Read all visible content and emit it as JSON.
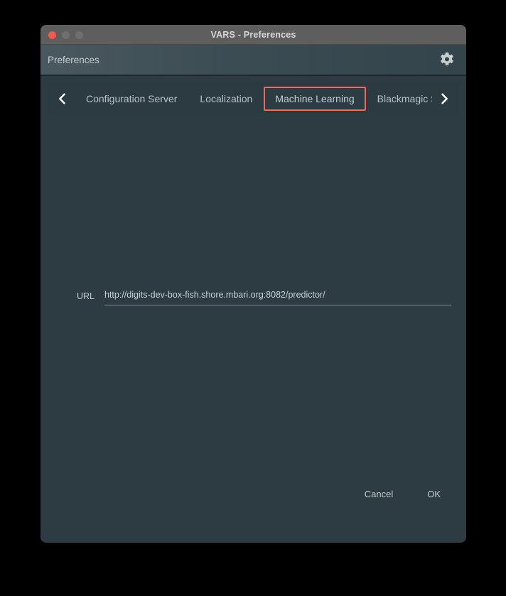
{
  "window": {
    "title": "VARS - Preferences",
    "traffic_lights": {
      "close": "close-button",
      "minimize": "minimize-button",
      "maximize": "maximize-button"
    },
    "colors": {
      "close": "#ef5b4c",
      "inactive": "#6f6f6f",
      "titlebar_bg": "#5e5e5e",
      "body_bg": "#2d3c43",
      "accent": "#ee6a5a",
      "text": "#c3cacc"
    }
  },
  "header": {
    "title": "Preferences",
    "gear_icon": "gear-icon"
  },
  "tabbar": {
    "prev_icon": "chevron-left-icon",
    "next_icon": "chevron-right-icon",
    "tabs": [
      {
        "label": "Configuration Server",
        "active": false
      },
      {
        "label": "Localization",
        "active": false
      },
      {
        "label": "Machine Learning",
        "active": true
      },
      {
        "label": "Blackmagic S",
        "active": false
      }
    ]
  },
  "content": {
    "fields": [
      {
        "label": "URL",
        "value": "http://digits-dev-box-fish.shore.mbari.org:8082/predictor/",
        "placeholder": ""
      }
    ]
  },
  "footer": {
    "cancel_label": "Cancel",
    "ok_label": "OK"
  }
}
